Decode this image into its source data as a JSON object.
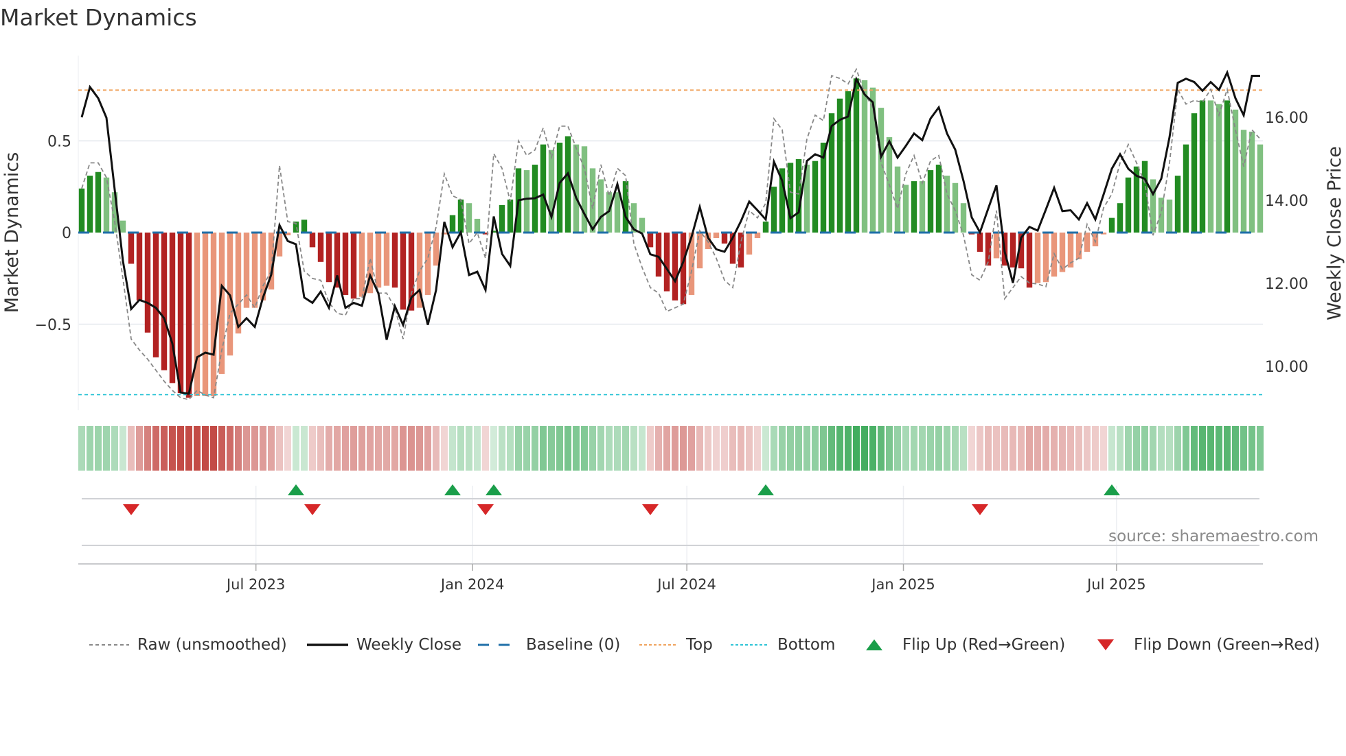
{
  "title": "Market Dynamics",
  "source": "source: sharemaestro.com",
  "colors": {
    "dark_green": "#228b22",
    "light_green": "#80c080",
    "dark_red": "#b22222",
    "light_red": "#e9967a",
    "close": "#111111",
    "raw": "#888888",
    "baseline": "#1f6fa8",
    "top": "#f0a35e",
    "bottom": "#2ec4d6",
    "flip_up": "#1a9e4a",
    "flip_down": "#d62728",
    "heat_green": "60,170,90",
    "heat_red": "195,75,70"
  },
  "legend": [
    {
      "label": "Raw (unsmoothed)",
      "icon": "dashed-gray-line"
    },
    {
      "label": "Weekly Close",
      "icon": "solid-black-line"
    },
    {
      "label": "Baseline (0)",
      "icon": "dashed-blue-line"
    },
    {
      "label": "Top",
      "icon": "dotted-orange-line"
    },
    {
      "label": "Bottom",
      "icon": "dotted-cyan-line"
    },
    {
      "label": "Flip Up (Red→Green)",
      "icon": "green-up-triangle"
    },
    {
      "label": "Flip Down (Green→Red)",
      "icon": "red-down-triangle"
    }
  ],
  "chart_data": {
    "type": "bar",
    "title": "Market Dynamics",
    "xlabel": "",
    "ylabel": "Market Dynamics",
    "y2label": "Weekly Close Price",
    "x_start": "2023-02-03",
    "x_step": "1 week",
    "ylim": [
      -0.98,
      0.95
    ],
    "y2lim": [
      8.9,
      17.6
    ],
    "yticks": [
      {
        "value": 0.5,
        "label": "0.5"
      },
      {
        "value": 0,
        "label": "0"
      },
      {
        "value": -0.5,
        "label": "−0.5"
      }
    ],
    "y2ticks": [
      {
        "value": 16,
        "label": "16.00"
      },
      {
        "value": 14,
        "label": "14.00"
      },
      {
        "value": 12,
        "label": "12.00"
      },
      {
        "value": 10,
        "label": "10.00"
      }
    ],
    "xticks": [
      {
        "label": "Jul 2023",
        "week": 21.14
      },
      {
        "label": "Jan 2024",
        "week": 47.43
      },
      {
        "label": "Jul 2024",
        "week": 73.43
      },
      {
        "label": "Jan 2025",
        "week": 99.71
      },
      {
        "label": "Jul 2025",
        "week": 125.57
      }
    ],
    "top_level": 0.776,
    "bottom_level": -0.883,
    "baseline": 0,
    "grid": true,
    "legend_position": "bottom",
    "series": [
      {
        "name": "Market Dynamics (smoothed)",
        "kind": "bar",
        "values": [
          0.24,
          0.31,
          0.33,
          0.3,
          0.22,
          0.065,
          -0.17,
          -0.37,
          -0.545,
          -0.68,
          -0.75,
          -0.82,
          -0.875,
          -0.9,
          -0.89,
          -0.89,
          -0.89,
          -0.77,
          -0.67,
          -0.55,
          -0.41,
          -0.41,
          -0.37,
          -0.31,
          -0.13,
          -0.015,
          0.06,
          0.07,
          -0.08,
          -0.16,
          -0.27,
          -0.3,
          -0.34,
          -0.36,
          -0.35,
          -0.33,
          -0.3,
          -0.29,
          -0.3,
          -0.42,
          -0.425,
          -0.41,
          -0.34,
          -0.18,
          -0.01,
          0.095,
          0.18,
          0.16,
          0.075,
          -0.01,
          0.01,
          0.15,
          0.18,
          0.35,
          0.34,
          0.37,
          0.48,
          0.45,
          0.49,
          0.525,
          0.48,
          0.47,
          0.35,
          0.29,
          0.22,
          0.22,
          0.28,
          0.16,
          0.08,
          -0.08,
          -0.24,
          -0.32,
          -0.37,
          -0.39,
          -0.34,
          -0.195,
          -0.09,
          -0.03,
          -0.06,
          -0.17,
          -0.19,
          -0.12,
          -0.03,
          0.06,
          0.25,
          0.35,
          0.38,
          0.4,
          0.37,
          0.39,
          0.49,
          0.65,
          0.73,
          0.77,
          0.84,
          0.83,
          0.79,
          0.68,
          0.52,
          0.36,
          0.26,
          0.28,
          0.28,
          0.34,
          0.37,
          0.31,
          0.27,
          0.16,
          -0.01,
          -0.105,
          -0.18,
          -0.14,
          -0.18,
          -0.19,
          -0.195,
          -0.3,
          -0.275,
          -0.27,
          -0.24,
          -0.215,
          -0.19,
          -0.145,
          -0.105,
          -0.075,
          -0.01,
          0.08,
          0.16,
          0.3,
          0.36,
          0.39,
          0.29,
          0.19,
          0.18,
          0.31,
          0.48,
          0.65,
          0.72,
          0.72,
          0.7,
          0.72,
          0.67,
          0.56,
          0.55,
          0.48
        ]
      },
      {
        "name": "Raw (unsmoothed)",
        "kind": "line",
        "values": [
          0.24,
          0.38,
          0.38,
          0.3,
          0.06,
          -0.25,
          -0.58,
          -0.64,
          -0.69,
          -0.75,
          -0.81,
          -0.86,
          -0.9,
          -0.91,
          -0.86,
          -0.885,
          -0.9,
          -0.64,
          -0.44,
          -0.39,
          -0.34,
          -0.41,
          -0.29,
          -0.21,
          0.365,
          0.06,
          0.05,
          -0.21,
          -0.25,
          -0.26,
          -0.38,
          -0.44,
          -0.45,
          -0.36,
          -0.36,
          -0.14,
          -0.33,
          -0.33,
          -0.41,
          -0.58,
          -0.33,
          -0.21,
          -0.14,
          0.03,
          0.32,
          0.2,
          0.18,
          -0.06,
          0.0,
          -0.14,
          0.43,
          0.35,
          0.17,
          0.5,
          0.42,
          0.45,
          0.57,
          0.41,
          0.58,
          0.58,
          0.46,
          0.35,
          0.13,
          0.37,
          0.2,
          0.35,
          0.31,
          -0.06,
          -0.19,
          -0.3,
          -0.33,
          -0.43,
          -0.41,
          -0.39,
          -0.21,
          0.01,
          -0.05,
          -0.14,
          -0.26,
          -0.3,
          -0.05,
          0.12,
          0.08,
          0.16,
          0.62,
          0.56,
          0.22,
          0.21,
          0.51,
          0.64,
          0.61,
          0.855,
          0.84,
          0.81,
          0.89,
          0.76,
          0.68,
          0.38,
          0.26,
          0.13,
          0.32,
          0.42,
          0.27,
          0.39,
          0.42,
          0.21,
          0.12,
          -0.015,
          -0.23,
          -0.26,
          -0.16,
          0.12,
          -0.36,
          -0.3,
          -0.24,
          -0.275,
          -0.28,
          -0.295,
          -0.115,
          -0.2,
          -0.165,
          -0.14,
          0.045,
          -0.05,
          0.135,
          0.21,
          0.38,
          0.48,
          0.38,
          0.27,
          -0.015,
          0.11,
          0.38,
          0.78,
          0.7,
          0.72,
          0.71,
          0.78,
          0.64,
          0.78,
          0.56,
          0.36,
          0.56,
          0.51
        ]
      },
      {
        "name": "Weekly Close",
        "kind": "line",
        "axis": "right",
        "values": [
          16.0,
          16.73,
          16.46,
          15.99,
          14.26,
          12.54,
          11.38,
          11.6,
          11.53,
          11.41,
          11.16,
          10.55,
          9.37,
          9.34,
          10.22,
          10.33,
          10.28,
          11.94,
          11.71,
          10.95,
          11.16,
          10.95,
          11.66,
          12.21,
          13.4,
          13.02,
          12.94,
          11.66,
          11.53,
          11.8,
          11.41,
          12.19,
          11.41,
          11.53,
          11.46,
          12.19,
          11.76,
          10.64,
          11.45,
          11.0,
          11.66,
          11.84,
          11.0,
          11.84,
          13.48,
          12.87,
          13.23,
          12.2,
          12.28,
          11.84,
          13.61,
          12.71,
          12.42,
          14.0,
          14.04,
          14.05,
          14.14,
          13.6,
          14.42,
          14.65,
          14.06,
          13.67,
          13.3,
          13.6,
          13.74,
          14.39,
          13.6,
          13.3,
          13.2,
          12.7,
          12.64,
          12.35,
          12.05,
          12.52,
          13.12,
          13.84,
          13.1,
          12.82,
          12.76,
          13.1,
          13.5,
          13.97,
          13.76,
          13.54,
          14.93,
          14.47,
          13.57,
          13.71,
          14.95,
          15.11,
          15.03,
          15.79,
          15.94,
          16.02,
          16.92,
          16.55,
          16.36,
          15.05,
          15.42,
          15.03,
          15.31,
          15.61,
          15.45,
          15.97,
          16.24,
          15.61,
          15.22,
          14.47,
          13.59,
          13.23,
          13.8,
          14.36,
          12.76,
          12.01,
          13.1,
          13.36,
          13.27,
          13.78,
          14.3,
          13.74,
          13.76,
          13.54,
          13.93,
          13.54,
          14.14,
          14.76,
          15.11,
          14.76,
          14.59,
          14.52,
          14.15,
          14.52,
          15.52,
          16.83,
          16.93,
          16.85,
          16.64,
          16.85,
          16.66,
          17.08,
          16.46,
          16.05,
          17.0,
          17.0
        ]
      }
    ],
    "flip_up_weeks": [
      26,
      45,
      50,
      83,
      125
    ],
    "flip_down_weeks": [
      6,
      28,
      49,
      69,
      109
    ]
  }
}
